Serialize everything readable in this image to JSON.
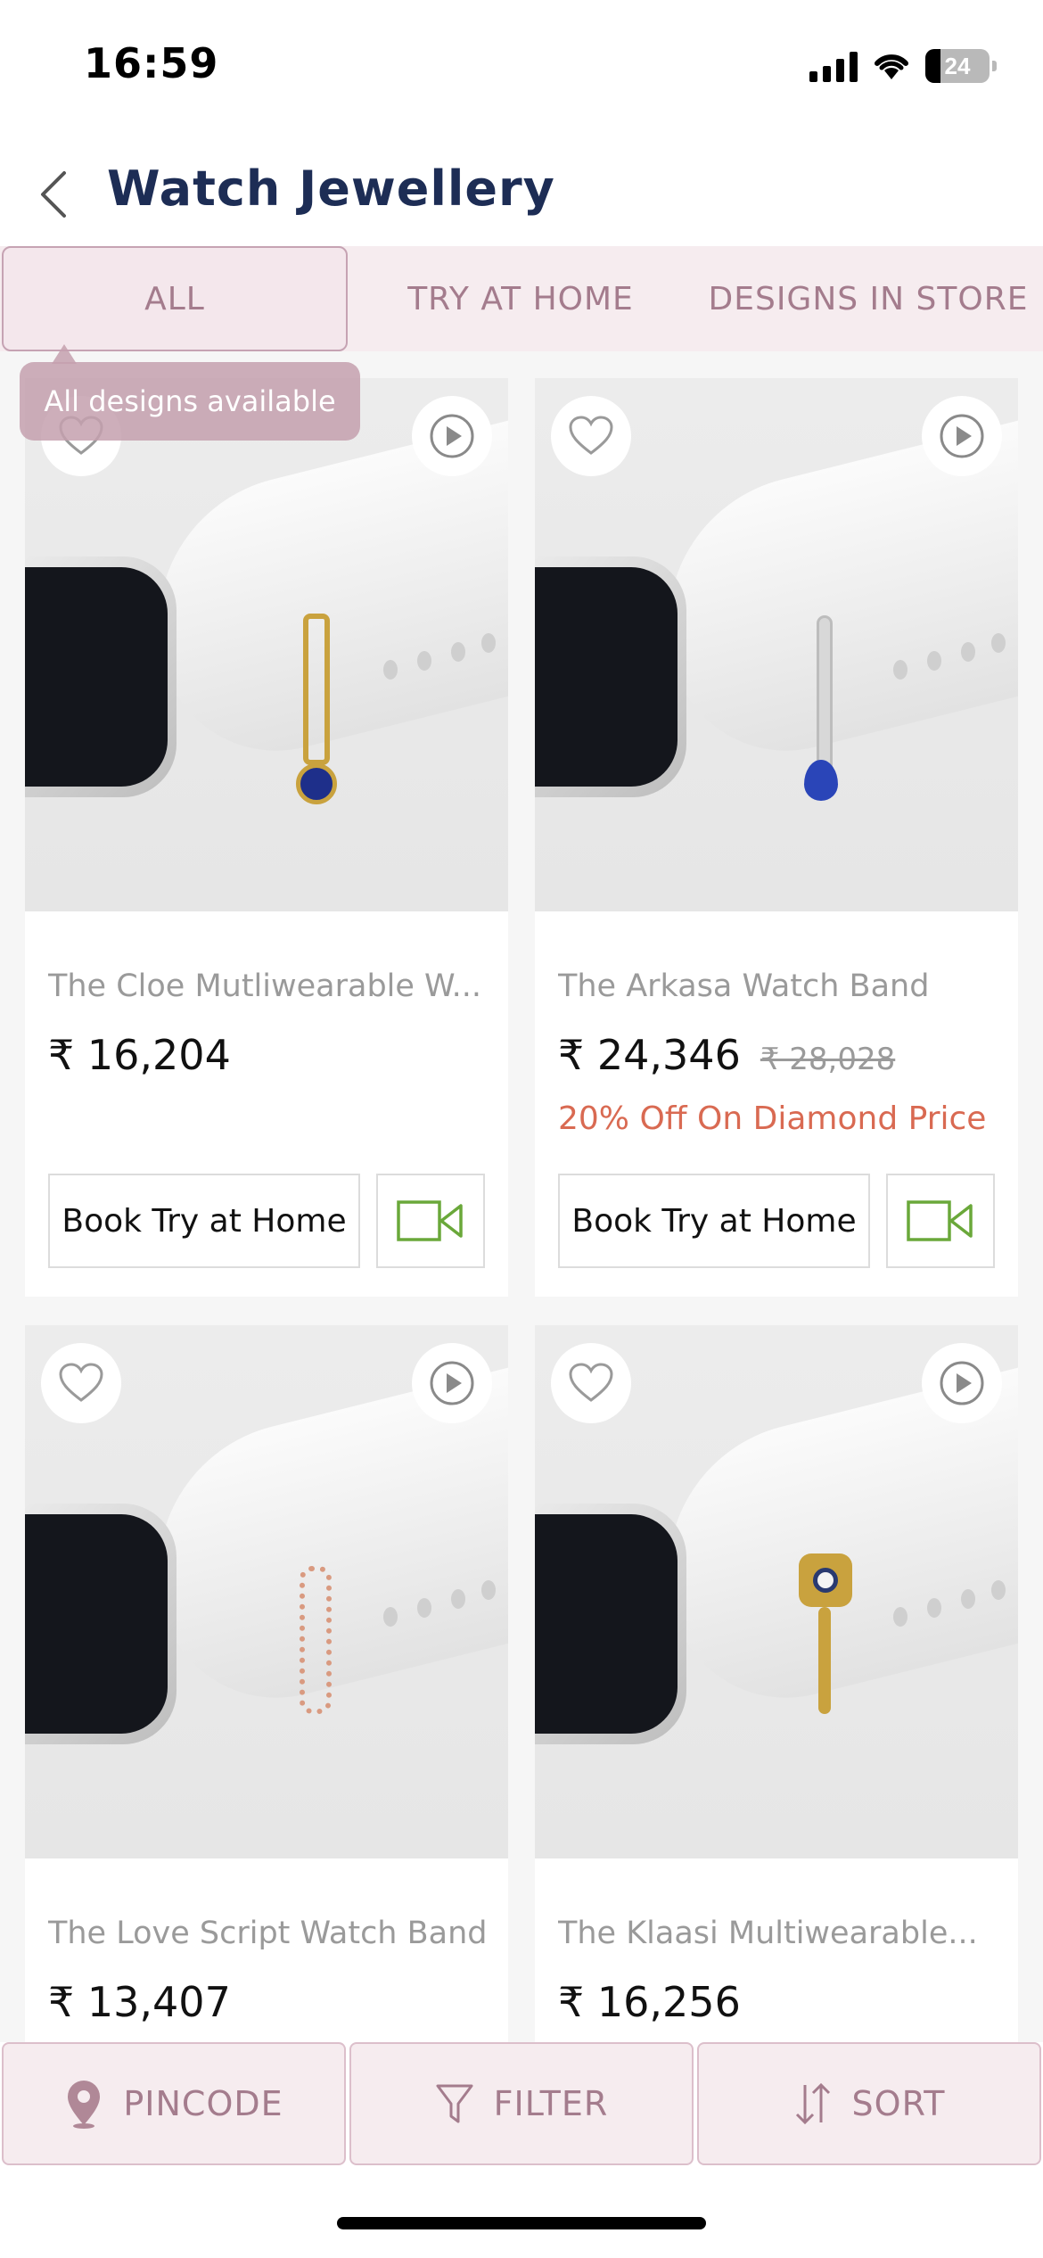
{
  "status_bar": {
    "time": "16:59",
    "battery": "24"
  },
  "header": {
    "title": "Watch Jewellery"
  },
  "tabs": [
    {
      "label": "ALL",
      "active": true
    },
    {
      "label": "TRY AT HOME",
      "active": false
    },
    {
      "label": "DESIGNS IN STORE",
      "active": false
    }
  ],
  "tooltip": {
    "text": "All designs available"
  },
  "products": [
    {
      "name": "The Cloe Mutliwearable W...",
      "price": "₹ 16,204",
      "mrp": "",
      "discount": "",
      "try_label": "Book Try at Home",
      "charm_color": "#c9a23e"
    },
    {
      "name": "The Arkasa Watch Band",
      "price": "₹ 24,346",
      "mrp": "₹ 28,028",
      "discount": "20% Off On Diamond Price",
      "try_label": "Book Try at Home",
      "charm_color": "#c7c7c7"
    },
    {
      "name": "The Love Script Watch Band",
      "price": "₹ 13,407",
      "mrp": "",
      "discount": "",
      "try_label": "",
      "charm_color": "#d99a80"
    },
    {
      "name": "The Klaasi Multiwearable...",
      "price": "₹ 16,256",
      "mrp": "",
      "discount": "",
      "try_label": "",
      "charm_color": "#c9a23e"
    }
  ],
  "bottom_bar": {
    "pincode": "PINCODE",
    "filter": "FILTER",
    "sort": "SORT"
  },
  "colors": {
    "accent": "#a47c8d",
    "title": "#1d2d55",
    "discount": "#d96a52",
    "video_icon": "#6aa83a"
  }
}
